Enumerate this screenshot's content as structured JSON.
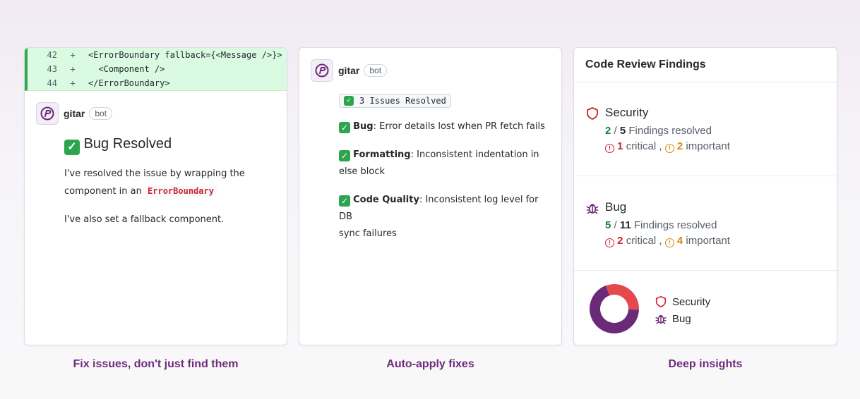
{
  "card1": {
    "diff": [
      {
        "num": "42",
        "sign": "+",
        "code": "<ErrorBoundary fallback={<Message />}>"
      },
      {
        "num": "43",
        "sign": "+",
        "code": "  <Component />"
      },
      {
        "num": "44",
        "sign": "+",
        "code": "</ErrorBoundary>"
      }
    ],
    "bot_name": "gitar",
    "bot_badge": "bot",
    "heading": "Bug Resolved",
    "para1_a": "I've resolved the issue by wrapping the",
    "para1_b": "component in an",
    "para1_code": "ErrorBoundary",
    "para2": "I've also set a fallback component."
  },
  "card2": {
    "bot_name": "gitar",
    "bot_badge": "bot",
    "pill": "3 Issues Resolved",
    "items": [
      {
        "label": "Bug",
        "text": "Error details lost when PR fetch fails",
        "text2": ""
      },
      {
        "label": "Formatting",
        "text": "Inconsistent indentation in",
        "text2": "else block"
      },
      {
        "label": "Code Quality",
        "text": "Inconsistent log level for DB",
        "text2": "sync failures"
      }
    ]
  },
  "card3": {
    "title": "Code Review Findings",
    "sections": [
      {
        "name": "Security",
        "icon": "shield-icon",
        "resolved": "2",
        "total": "5",
        "resolved_label": "Findings resolved",
        "critical": "1",
        "critical_label": "critical",
        "important": "2",
        "important_label": "important"
      },
      {
        "name": "Bug",
        "icon": "bug-icon",
        "resolved": "5",
        "total": "11",
        "resolved_label": "Findings resolved",
        "critical": "2",
        "critical_label": "critical",
        "important": "4",
        "important_label": "important"
      }
    ],
    "legend": [
      {
        "name": "Security",
        "color": "#e5484d"
      },
      {
        "name": "Bug",
        "color": "#6b2a78"
      }
    ],
    "donut": {
      "security_fraction": 0.3125,
      "bug_fraction": 0.6875
    }
  },
  "captions": {
    "c1": "Fix issues, don't just find them",
    "c2": "Auto-apply fixes",
    "c3": "Deep insights"
  },
  "colors": {
    "accent": "#6f2b7e",
    "diff_bg": "#dafbe1",
    "diff_bar": "#2fa84f",
    "red": "#cf222e",
    "orange": "#d48806",
    "green": "#1a7f37"
  }
}
